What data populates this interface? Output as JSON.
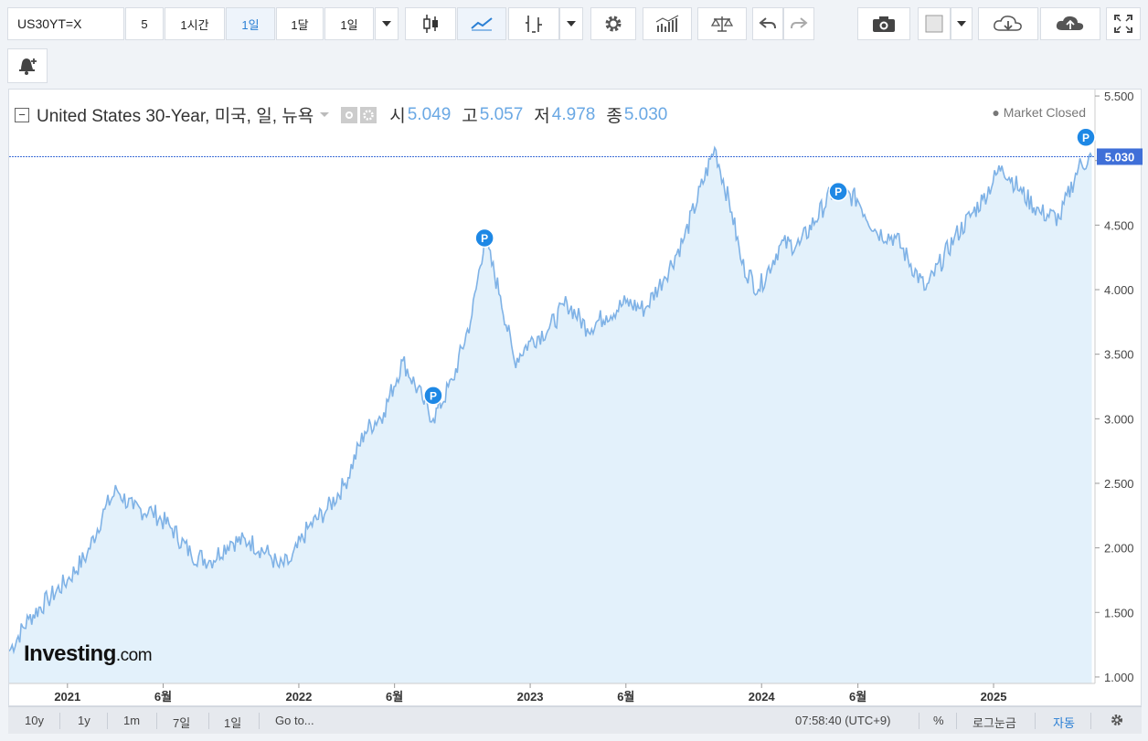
{
  "toolbar": {
    "symbol": "US30YT=X",
    "interval_5": "5",
    "interval_1h": "1시간",
    "interval_1d": "1일",
    "interval_1m": "1달",
    "interval_custom": "1일"
  },
  "legend": {
    "title": "United States 30-Year, 미국, 일, 뉴욕",
    "open_label": "시",
    "open": "5.049",
    "high_label": "고",
    "high": "5.057",
    "low_label": "저",
    "low": "4.978",
    "close_label": "종",
    "close": "5.030",
    "status": "● Market Closed"
  },
  "logo": {
    "main": "Investing",
    "suffix": ".com"
  },
  "bottombar": {
    "ranges": [
      "10y",
      "1y",
      "1m",
      "7일",
      "1일"
    ],
    "goto": "Go to...",
    "clock": "07:58:40 (UTC+9)",
    "percent": "%",
    "log": "로그눈금",
    "auto": "자동"
  },
  "colors": {
    "line": "#7fb2e6",
    "area": "#e3f1fb",
    "marker": "#1e88e5",
    "last_price_bg": "#3f6fd8"
  },
  "chart_data": {
    "type": "area",
    "ylim": [
      0.95,
      5.55
    ],
    "xlim": [
      "2020-10-01",
      "2025-06-10"
    ],
    "yticks": [
      "1.000",
      "1.500",
      "2.000",
      "2.500",
      "3.000",
      "3.500",
      "4.000",
      "4.500",
      "5.000",
      "5.500"
    ],
    "xticks": [
      {
        "date": "2021-01-01",
        "label": "2021"
      },
      {
        "date": "2021-06-01",
        "label": "6월"
      },
      {
        "date": "2022-01-01",
        "label": "2022"
      },
      {
        "date": "2022-06-01",
        "label": "6월"
      },
      {
        "date": "2023-01-01",
        "label": "2023"
      },
      {
        "date": "2023-06-01",
        "label": "6월"
      },
      {
        "date": "2024-01-01",
        "label": "2024"
      },
      {
        "date": "2024-06-01",
        "label": "6월"
      },
      {
        "date": "2025-01-01",
        "label": "2025"
      }
    ],
    "last_price": 5.03,
    "last_price_label": "5.030",
    "x": [
      "2020-10-01",
      "2020-11-01",
      "2020-12-01",
      "2021-01-01",
      "2021-02-01",
      "2021-03-01",
      "2021-03-20",
      "2021-04-15",
      "2021-05-15",
      "2021-06-15",
      "2021-07-15",
      "2021-08-15",
      "2021-09-15",
      "2021-10-15",
      "2021-11-15",
      "2021-12-01",
      "2021-12-20",
      "2022-01-15",
      "2022-02-15",
      "2022-03-15",
      "2022-04-15",
      "2022-05-15",
      "2022-06-14",
      "2022-07-15",
      "2022-08-01",
      "2022-09-01",
      "2022-10-01",
      "2022-10-21",
      "2022-11-15",
      "2022-12-07",
      "2023-01-01",
      "2023-01-31",
      "2023-02-28",
      "2023-04-01",
      "2023-05-01",
      "2023-06-01",
      "2023-07-01",
      "2023-08-01",
      "2023-09-01",
      "2023-10-19",
      "2023-11-15",
      "2023-12-01",
      "2023-12-27",
      "2024-01-31",
      "2024-03-01",
      "2024-04-25",
      "2024-05-31",
      "2024-06-30",
      "2024-07-31",
      "2024-09-16",
      "2024-10-31",
      "2024-11-30",
      "2024-12-15",
      "2025-01-14",
      "2025-02-15",
      "2025-03-15",
      "2025-04-15",
      "2025-05-15",
      "2025-06-05"
    ],
    "values": [
      1.2,
      1.45,
      1.6,
      1.75,
      1.95,
      2.3,
      2.45,
      2.3,
      2.28,
      2.15,
      1.95,
      1.9,
      2.05,
      2.05,
      1.95,
      1.85,
      1.9,
      2.15,
      2.3,
      2.5,
      2.9,
      3.05,
      3.45,
      3.15,
      3.0,
      3.3,
      3.8,
      4.4,
      3.95,
      3.45,
      3.6,
      3.7,
      3.9,
      3.7,
      3.8,
      3.9,
      3.85,
      4.1,
      4.4,
      5.1,
      4.6,
      4.2,
      4.0,
      4.35,
      4.35,
      4.78,
      4.7,
      4.45,
      4.4,
      4.0,
      4.4,
      4.6,
      4.7,
      4.96,
      4.75,
      4.6,
      4.55,
      4.95,
      5.03
    ],
    "p_markers": [
      {
        "date": "2022-08-01",
        "value": 3.18
      },
      {
        "date": "2022-10-21",
        "value": 4.4
      },
      {
        "date": "2024-05-01",
        "value": 4.76
      },
      {
        "date": "2025-06-05",
        "value": 5.18
      }
    ]
  }
}
